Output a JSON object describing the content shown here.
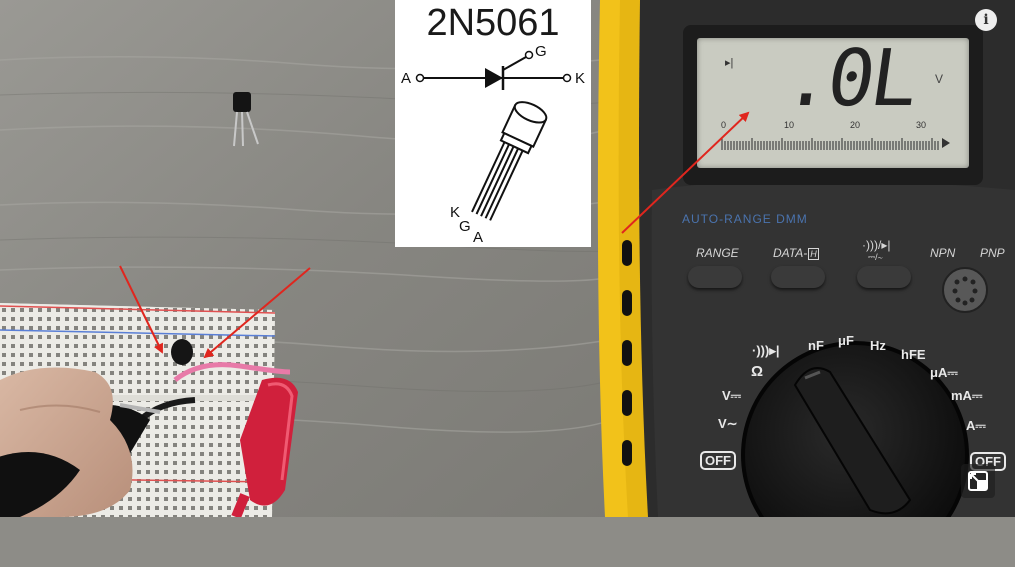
{
  "info_card": {
    "part_number": "2N5061",
    "pins_schematic": {
      "anode": "A",
      "gate": "G",
      "cathode": "K"
    },
    "pins_package": {
      "k": "K",
      "g": "G",
      "a": "A"
    }
  },
  "multimeter": {
    "reading": ".0L",
    "unit": "V",
    "scale_ticks": [
      "0",
      "10",
      "20",
      "30"
    ],
    "model_label": "AUTO-RANGE DMM",
    "buttons": {
      "range": "RANGE",
      "data": "DATA-",
      "data_hold": "H",
      "mode": "·)))/▸|"
    },
    "mode_sub": "⎓/∼",
    "socket": {
      "npn": "NPN",
      "pnp": "PNP"
    },
    "dial": {
      "ohm": "Ω",
      "diode": "·)))▸|",
      "nf": "nF",
      "uf": "μF",
      "hz": "Hz",
      "hfe": "hFE",
      "ua": "μA⎓",
      "ma": "mA⎓",
      "a": "A⎓",
      "vdc": "V⎓",
      "vac": "V∼",
      "off_left": "OFF",
      "off_right": "OFF"
    }
  },
  "overlay_controls": {
    "info_icon": "i"
  },
  "colors": {
    "annotation_arrow": "#e0261e",
    "meter_case": "#f2c21a",
    "lcd": "#c9cbc1"
  }
}
